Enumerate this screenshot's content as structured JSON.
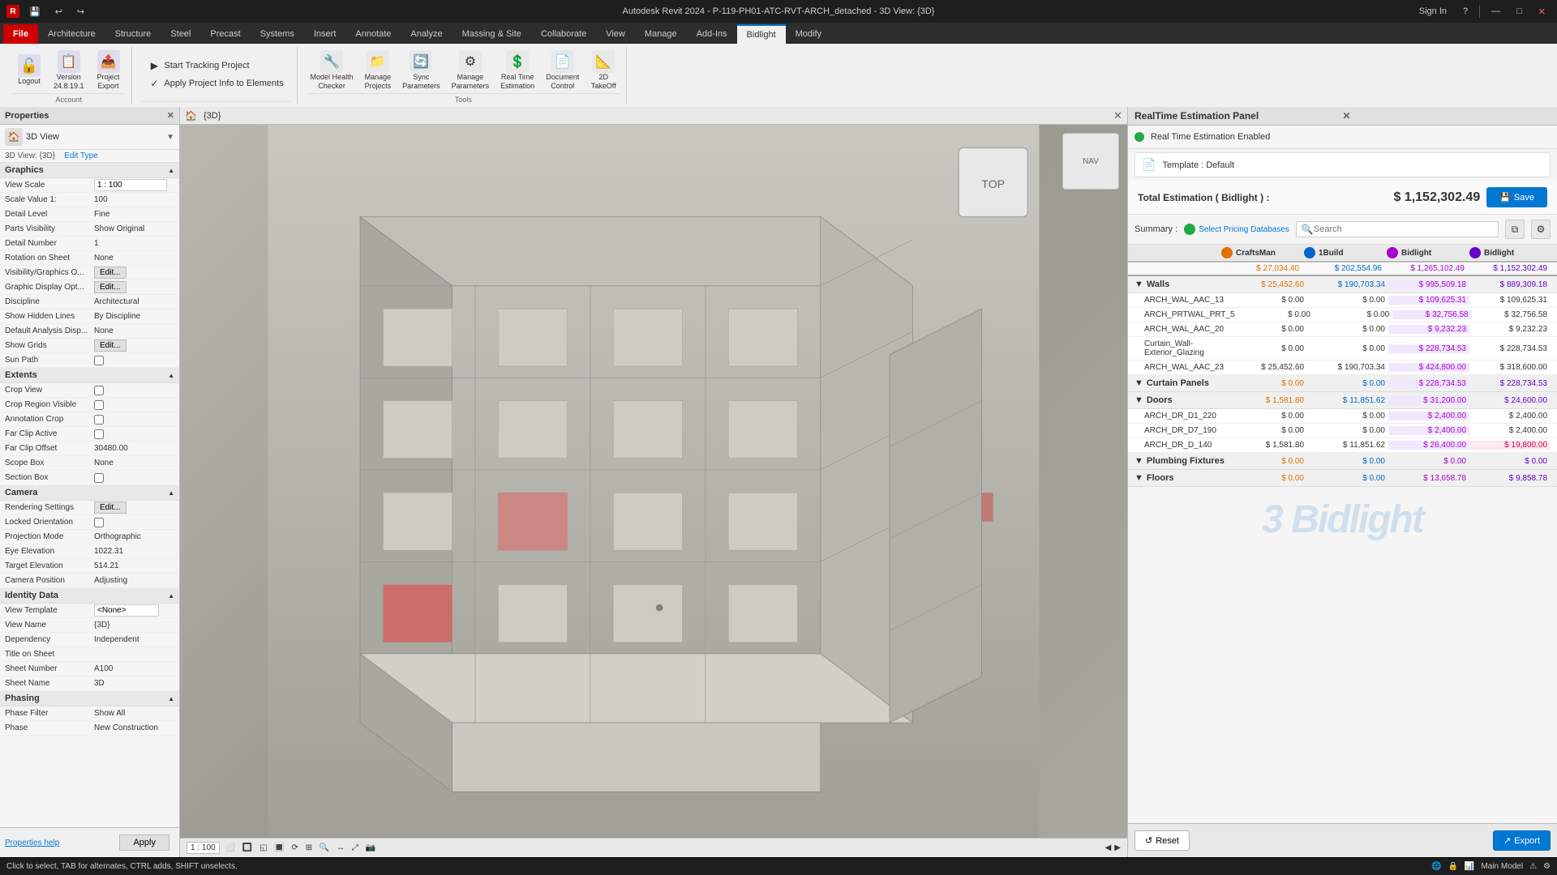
{
  "titlebar": {
    "title": "Autodesk Revit 2024 - P-119-PH01-ATC-RVT-ARCH_detached - 3D View: {3D}",
    "sign_in": "Sign In",
    "help_icon": "?",
    "minimize": "—",
    "maximize": "□",
    "close": "✕"
  },
  "ribbon": {
    "tabs": [
      "File",
      "Architecture",
      "Structure",
      "Steel",
      "Precast",
      "Systems",
      "Insert",
      "Annotate",
      "Analyze",
      "Massing & Site",
      "Collaborate",
      "View",
      "Manage",
      "Add-Ins",
      "Bidlight",
      "Modify"
    ],
    "active_tab": "Bidlight",
    "account_group": {
      "title": "Account",
      "items": [
        {
          "label": "Logout",
          "icon": "🔓"
        },
        {
          "label": "Version\n24.8.19.1",
          "icon": "📋"
        },
        {
          "label": "Project\nExport",
          "icon": "📤"
        }
      ]
    },
    "tracking_group": {
      "title": "",
      "items": [
        {
          "label": "Start Tracking Project",
          "icon": "▶"
        },
        {
          "label": "Apply Project Info to Elements",
          "icon": "✓"
        }
      ]
    },
    "tools_group": {
      "title": "Tools",
      "items": [
        {
          "label": "Model Health\nChecker",
          "icon": "🔧"
        },
        {
          "label": "Manage\nProjects",
          "icon": "📁"
        },
        {
          "label": "Sync\nParameters",
          "icon": "🔄"
        },
        {
          "label": "Manage\nParameters",
          "icon": "⚙"
        },
        {
          "label": "Real Time\nEstimation",
          "icon": "💲"
        },
        {
          "label": "Document\nControl",
          "icon": "📄"
        },
        {
          "label": "2D\nTakeOff",
          "icon": "📐"
        }
      ]
    }
  },
  "properties": {
    "title": "Properties",
    "view_type": "3D View",
    "view_label": "3D View: {3D}",
    "edit_type": "Edit Type",
    "sections": {
      "graphics": {
        "title": "Graphics",
        "fields": [
          {
            "label": "View Scale",
            "value": "1 : 100",
            "type": "input"
          },
          {
            "label": "Scale Value  1:",
            "value": "100",
            "type": "text"
          },
          {
            "label": "Detail Level",
            "value": "Fine",
            "type": "text"
          },
          {
            "label": "Parts Visibility",
            "value": "Show Original",
            "type": "text"
          },
          {
            "label": "Detail Number",
            "value": "1",
            "type": "text"
          },
          {
            "label": "Rotation on Sheet",
            "value": "None",
            "type": "text"
          },
          {
            "label": "Visibility/Graphics O...",
            "value": "Edit...",
            "type": "btn"
          },
          {
            "label": "Graphic Display Opt...",
            "value": "Edit...",
            "type": "btn"
          },
          {
            "label": "Discipline",
            "value": "Architectural",
            "type": "text"
          },
          {
            "label": "Show Hidden Lines",
            "value": "By Discipline",
            "type": "text"
          },
          {
            "label": "Default Analysis Disp...",
            "value": "None",
            "type": "text"
          },
          {
            "label": "Show Grids",
            "value": "Edit...",
            "type": "btn"
          },
          {
            "label": "Sun Path",
            "value": "",
            "type": "checkbox",
            "checked": false
          }
        ]
      },
      "extents": {
        "title": "Extents",
        "fields": [
          {
            "label": "Crop View",
            "value": "",
            "type": "checkbox",
            "checked": false
          },
          {
            "label": "Crop Region Visible",
            "value": "",
            "type": "checkbox",
            "checked": false
          },
          {
            "label": "Annotation Crop",
            "value": "",
            "type": "checkbox",
            "checked": false
          },
          {
            "label": "Far Clip Active",
            "value": "",
            "type": "checkbox",
            "checked": false
          },
          {
            "label": "Far Clip Offset",
            "value": "30480.00",
            "type": "text"
          },
          {
            "label": "Scope Box",
            "value": "None",
            "type": "text"
          },
          {
            "label": "Section Box",
            "value": "",
            "type": "checkbox",
            "checked": false
          }
        ]
      },
      "camera": {
        "title": "Camera",
        "fields": [
          {
            "label": "Rendering Settings",
            "value": "Edit...",
            "type": "btn"
          },
          {
            "label": "Locked Orientation",
            "value": "",
            "type": "checkbox",
            "checked": false
          },
          {
            "label": "Projection Mode",
            "value": "Orthographic",
            "type": "text"
          },
          {
            "label": "Eye Elevation",
            "value": "1022.31",
            "type": "text"
          },
          {
            "label": "Target Elevation",
            "value": "514.21",
            "type": "text"
          },
          {
            "label": "Camera Position",
            "value": "Adjusting",
            "type": "text"
          }
        ]
      },
      "identity": {
        "title": "Identity Data",
        "fields": [
          {
            "label": "View Template",
            "value": "<None>",
            "type": "input"
          },
          {
            "label": "View Name",
            "value": "{3D}",
            "type": "text"
          },
          {
            "label": "Dependency",
            "value": "Independent",
            "type": "text"
          },
          {
            "label": "Title on Sheet",
            "value": "",
            "type": "text"
          },
          {
            "label": "Sheet Number",
            "value": "A100",
            "type": "text"
          },
          {
            "label": "Sheet Name",
            "value": "3D",
            "type": "text"
          }
        ]
      },
      "phasing": {
        "title": "Phasing",
        "fields": [
          {
            "label": "Phase Filter",
            "value": "Show All",
            "type": "text"
          },
          {
            "label": "Phase",
            "value": "New Construction",
            "type": "text"
          }
        ]
      }
    },
    "apply_btn": "Apply",
    "help_link": "Properties help"
  },
  "viewport": {
    "title": "{3D}",
    "scale": "1 : 100",
    "cursor_hint": "Click to select, TAB for alternates, CTRL adds, SHIFT unselects."
  },
  "estimation": {
    "panel_title": "RealTime Estimation Panel",
    "enabled_label": "Real Time Estimation Enabled",
    "template_label": "Template : Default",
    "total_label": "Total Estimation ( Bidlight ) :",
    "total_value": "$ 1,152,302.49",
    "save_btn": "Save",
    "summary_label": "Summary :",
    "pricing_btn": "Select Pricing Databases",
    "search_placeholder": "Search",
    "columns": [
      {
        "name": "CraftsMan",
        "value": "$ 27,034.40",
        "color": "#e07000",
        "icon_class": "col-craftsman"
      },
      {
        "name": "1Build",
        "value": "$ 202,554.96",
        "color": "#0066cc",
        "icon_class": "col-1build"
      },
      {
        "name": "Bidlight",
        "value": "$ 1,265,102.49",
        "color": "#aa00cc",
        "icon_class": "col-bidlight1"
      },
      {
        "name": "Bidlight",
        "value": "$ 1,152,302.49",
        "color": "#6600cc",
        "icon_class": "col-bidlight2"
      }
    ],
    "categories": [
      {
        "name": "Walls",
        "expanded": true,
        "values": [
          "$ 25,452.60",
          "$ 190,703.34",
          "$ 995,509.18",
          "$ 889,309.18"
        ],
        "items": [
          {
            "name": "ARCH_WAL_AAC_13",
            "values": [
              "$ 0.00",
              "$ 0.00",
              "$ 109,625.31",
              "$ 109,625.31"
            ]
          },
          {
            "name": "ARCH_PRTWAL_PRT_5",
            "values": [
              "$ 0.00",
              "$ 0.00",
              "$ 32,756.58",
              "$ 32,756.58"
            ]
          },
          {
            "name": "ARCH_WAL_AAC_20",
            "values": [
              "$ 0.00",
              "$ 0.00",
              "$ 9,232.23",
              "$ 9,232.23"
            ]
          },
          {
            "name": "Curtain_Wall-Exterior_Glazing",
            "values": [
              "$ 0.00",
              "$ 0.00",
              "$ 228,734.53",
              "$ 228,734.53"
            ]
          },
          {
            "name": "ARCH_WAL_AAC_23",
            "values": [
              "$ 25,452.60",
              "$ 190,703.34",
              "$ 424,800.00",
              "$ 318,600.00"
            ]
          }
        ]
      },
      {
        "name": "Curtain Panels",
        "expanded": false,
        "values": [
          "$ 0.00",
          "$ 0.00",
          "$ 228,734.53",
          "$ 228,734.53"
        ],
        "items": []
      },
      {
        "name": "Doors",
        "expanded": true,
        "values": [
          "$ 1,581.80",
          "$ 11,851.62",
          "$ 31,200.00",
          "$ 24,600.00"
        ],
        "items": [
          {
            "name": "ARCH_DR_D1_220",
            "values": [
              "$ 0.00",
              "$ 0.00",
              "$ 2,400.00",
              "$ 2,400.00"
            ]
          },
          {
            "name": "ARCH_DR_D7_190",
            "values": [
              "$ 0.00",
              "$ 0.00",
              "$ 2,400.00",
              "$ 2,400.00"
            ]
          },
          {
            "name": "ARCH_DR_D_140",
            "values": [
              "$ 1,581.80",
              "$ 11,851.62",
              "$ 26,400.00",
              "$ 19,800.00"
            ]
          }
        ]
      },
      {
        "name": "Plumbing Fixtures",
        "expanded": false,
        "values": [
          "$ 0.00",
          "$ 0.00",
          "$ 0.00",
          "$ 0.00"
        ],
        "items": []
      },
      {
        "name": "Floors",
        "expanded": false,
        "values": [
          "$ 0.00",
          "$ 0.00",
          "$ 13,658.78",
          "$ 9,858.78"
        ],
        "items": []
      }
    ],
    "reset_btn": "Reset",
    "export_btn": "Export"
  },
  "statusbar": {
    "message": "Click to select, TAB for alternates, CTRL adds, SHIFT unselects.",
    "model": "Main Model",
    "view_scale": "1 : 100"
  }
}
